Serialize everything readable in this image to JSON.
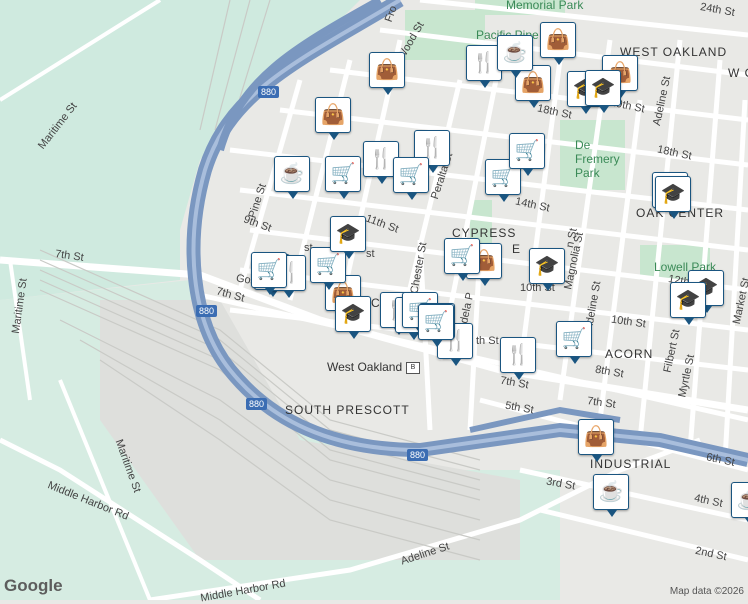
{
  "map": {
    "areas": [
      {
        "id": "west-oakland",
        "text": "WEST OAKLAND"
      },
      {
        "id": "cypress",
        "text": "CYPRESS"
      },
      {
        "id": "acorn",
        "text": "ACORN"
      },
      {
        "id": "south-prescott",
        "text": "SOUTH PRESCOTT"
      },
      {
        "id": "industrial",
        "text": "INDUSTRIAL"
      },
      {
        "id": "oak-center",
        "text": "OAK CENTER"
      },
      {
        "id": "w-partial",
        "text": "W O"
      }
    ],
    "parks": [
      {
        "id": "memorial-park",
        "text": "Memorial Park"
      },
      {
        "id": "de-fremery-park",
        "text": "De Fremery Park"
      },
      {
        "id": "lowell-park",
        "text": "Lowell Park"
      },
      {
        "id": "pacific-pipe",
        "text": "Pacific Pipe"
      }
    ],
    "streets": [
      {
        "id": "maritime-st-1",
        "text": "Maritime St"
      },
      {
        "id": "maritime-st-2",
        "text": "Maritime St"
      },
      {
        "id": "maritime-st-3",
        "text": "Maritime St"
      },
      {
        "id": "middle-harbor-1",
        "text": "Middle Harbor Rd"
      },
      {
        "id": "middle-harbor-2",
        "text": "Middle Harbor Rd"
      },
      {
        "id": "adeline-st-low",
        "text": "Adeline St"
      },
      {
        "id": "adeline-st-high",
        "text": "Adeline St"
      },
      {
        "id": "adeline-st-mid",
        "text": "Adeline St"
      },
      {
        "id": "seventh-st-w",
        "text": "7th St"
      },
      {
        "id": "seventh-st-mid",
        "text": "7th St"
      },
      {
        "id": "seventh-st-e1",
        "text": "7th St"
      },
      {
        "id": "seventh-st-e2",
        "text": "7th St"
      },
      {
        "id": "pine-st",
        "text": "Pine St"
      },
      {
        "id": "ninth-st",
        "text": "9th St"
      },
      {
        "id": "eleventh-st",
        "text": "11th St"
      },
      {
        "id": "peralta-st",
        "text": "Peralta St"
      },
      {
        "id": "chester-st",
        "text": "Chester St"
      },
      {
        "id": "wood-st",
        "text": "Wood St"
      },
      {
        "id": "frontage",
        "text": "Fro"
      },
      {
        "id": "mandela",
        "text": "ndela P"
      },
      {
        "id": "fourteenth-st",
        "text": "14th St"
      },
      {
        "id": "tenth-st-1",
        "text": "10th St"
      },
      {
        "id": "tenth-st-2",
        "text": "10th St"
      },
      {
        "id": "twelfth-st",
        "text": "12th St"
      },
      {
        "id": "eighth-st",
        "text": "8th St"
      },
      {
        "id": "fifth-st",
        "text": "5th St"
      },
      {
        "id": "sixth-st",
        "text": "6th St"
      },
      {
        "id": "fourth-st",
        "text": "4th St"
      },
      {
        "id": "third-st",
        "text": "3rd St"
      },
      {
        "id": "second-st",
        "text": "2nd St"
      },
      {
        "id": "eighteenth-st-1",
        "text": "18th St"
      },
      {
        "id": "eighteenth-st-2",
        "text": "18th St"
      },
      {
        "id": "nineteenth-st",
        "text": "19th St"
      },
      {
        "id": "twentyfourth-st",
        "text": "24th St"
      },
      {
        "id": "magnolia-st",
        "text": "Magnolia St"
      },
      {
        "id": "filbert-st",
        "text": "Filbert St"
      },
      {
        "id": "myrtle-st",
        "text": "Myrtle St"
      },
      {
        "id": "market-st",
        "text": "Market St"
      },
      {
        "id": "gos",
        "text": "Gos"
      },
      {
        "id": "st-frag",
        "text": "st"
      },
      {
        "id": "st-frag2",
        "text": "st"
      },
      {
        "id": "st-frag3",
        "text": "th St"
      },
      {
        "id": "st-frag4",
        "text": "St"
      },
      {
        "id": "hotel-frag",
        "text": "C"
      },
      {
        "id": "ad-frag",
        "text": "A"
      },
      {
        "id": "n-st-frag",
        "text": "n St"
      },
      {
        "id": "cypress-2",
        "text": "E"
      }
    ],
    "station": {
      "text": "West Oakland"
    },
    "highway_shields": [
      {
        "id": "shield-1",
        "text": "880"
      },
      {
        "id": "shield-2",
        "text": "880"
      },
      {
        "id": "shield-3",
        "text": "880"
      },
      {
        "id": "shield-4",
        "text": "880"
      }
    ]
  },
  "pins": [
    {
      "id": "shop-1",
      "icon": "bag-icon",
      "glyph": "👜"
    },
    {
      "id": "shop-2",
      "icon": "bag-icon",
      "glyph": "👜"
    },
    {
      "id": "shop-3",
      "icon": "bag-icon",
      "glyph": "👜"
    },
    {
      "id": "shop-4",
      "icon": "bag-icon",
      "glyph": "👜"
    },
    {
      "id": "shop-5",
      "icon": "bag-icon",
      "glyph": "👜"
    },
    {
      "id": "shop-6",
      "icon": "bag-icon",
      "glyph": "👜"
    },
    {
      "id": "shop-7",
      "icon": "bag-icon",
      "glyph": "👜"
    },
    {
      "id": "shop-8",
      "icon": "bag-icon",
      "glyph": "👜"
    },
    {
      "id": "food-1",
      "icon": "fork-knife-icon",
      "glyph": "🍴"
    },
    {
      "id": "food-2",
      "icon": "fork-knife-icon",
      "glyph": "🍴"
    },
    {
      "id": "food-3",
      "icon": "fork-knife-icon",
      "glyph": "🍴"
    },
    {
      "id": "food-4",
      "icon": "fork-knife-icon",
      "glyph": "🍴"
    },
    {
      "id": "food-5",
      "icon": "fork-knife-icon",
      "glyph": "🍴"
    },
    {
      "id": "food-6",
      "icon": "fork-knife-icon",
      "glyph": "🍴"
    },
    {
      "id": "food-7",
      "icon": "fork-knife-icon",
      "glyph": "🍴"
    },
    {
      "id": "food-8",
      "icon": "fork-knife-icon",
      "glyph": "🍴"
    },
    {
      "id": "food-9",
      "icon": "fork-knife-icon",
      "glyph": "🍴"
    },
    {
      "id": "cafe-1",
      "icon": "coffee-cup-icon",
      "glyph": "☕"
    },
    {
      "id": "cafe-2",
      "icon": "coffee-cup-icon",
      "glyph": "☕"
    },
    {
      "id": "cafe-3",
      "icon": "coffee-cup-icon",
      "glyph": "☕"
    },
    {
      "id": "cafe-4",
      "icon": "coffee-cup-icon",
      "glyph": "☕"
    },
    {
      "id": "cart-1",
      "icon": "shopping-cart-icon",
      "glyph": "🛒"
    },
    {
      "id": "cart-2",
      "icon": "shopping-cart-icon",
      "glyph": "🛒"
    },
    {
      "id": "cart-3",
      "icon": "shopping-cart-icon",
      "glyph": "🛒"
    },
    {
      "id": "cart-4",
      "icon": "shopping-cart-icon",
      "glyph": "🛒"
    },
    {
      "id": "cart-5",
      "icon": "shopping-cart-icon",
      "glyph": "🛒"
    },
    {
      "id": "cart-6",
      "icon": "shopping-cart-icon",
      "glyph": "🛒"
    },
    {
      "id": "cart-7",
      "icon": "shopping-cart-icon",
      "glyph": "🛒"
    },
    {
      "id": "cart-8",
      "icon": "shopping-cart-icon",
      "glyph": "🛒"
    },
    {
      "id": "cart-9",
      "icon": "shopping-cart-icon",
      "glyph": "🛒"
    },
    {
      "id": "cart-10",
      "icon": "shopping-cart-icon",
      "glyph": "🛒"
    },
    {
      "id": "cart-11",
      "icon": "shopping-cart-icon",
      "glyph": "🛒"
    },
    {
      "id": "school-1",
      "icon": "graduation-cap-icon",
      "glyph": "🎓"
    },
    {
      "id": "school-2",
      "icon": "graduation-cap-icon",
      "glyph": "🎓"
    },
    {
      "id": "school-3",
      "icon": "graduation-cap-icon",
      "glyph": "🎓"
    },
    {
      "id": "school-4",
      "icon": "graduation-cap-icon",
      "glyph": "🎓"
    },
    {
      "id": "school-5",
      "icon": "graduation-cap-icon",
      "glyph": "🎓"
    },
    {
      "id": "school-6",
      "icon": "graduation-cap-icon",
      "glyph": "🎓"
    },
    {
      "id": "school-7",
      "icon": "graduation-cap-icon",
      "glyph": "🎓"
    },
    {
      "id": "school-8",
      "icon": "graduation-cap-icon",
      "glyph": "🎓"
    },
    {
      "id": "school-9",
      "icon": "graduation-cap-icon",
      "glyph": "🎓"
    }
  ],
  "footer": {
    "logo": "Google",
    "attribution": "Map data ©2026"
  },
  "colors": {
    "pin_border": "#1a5580",
    "pin_icon": "#0f3f63",
    "park": "#c8e6cf",
    "freeway": "#7a97c0",
    "water": "#dcece4"
  }
}
